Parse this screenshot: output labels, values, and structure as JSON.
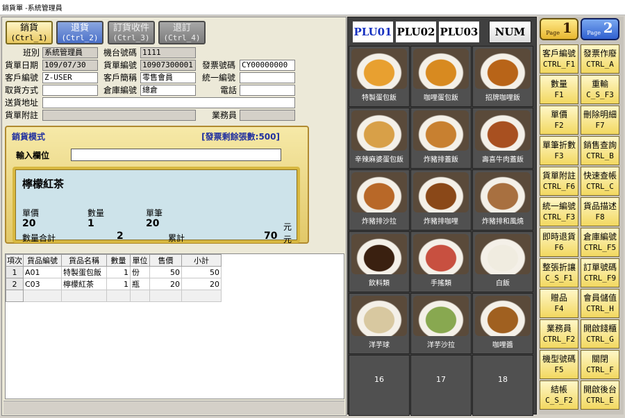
{
  "window": {
    "title": "銷貨單 -系統管理員"
  },
  "mode_tabs": [
    {
      "label": "銷貨",
      "key": "(Ctrl_1)"
    },
    {
      "label": "退貨",
      "key": "(Ctrl_2)"
    },
    {
      "label": "訂貨收件",
      "key": "(Ctrl_3)"
    },
    {
      "label": "退訂",
      "key": "(Ctrl_4)"
    }
  ],
  "header": {
    "shift_label": "班別",
    "shift_value": "系統管理員",
    "machine_label": "機台號碼",
    "machine_value": "1111",
    "date_label": "貨單日期",
    "date_value": "109/07/30",
    "order_no_label": "貨單編號",
    "order_no_value": "10907300001",
    "invoice_no_label": "發票號碼",
    "invoice_no_value": "CY00000000",
    "customer_id_label": "客戶編號",
    "customer_id_value": "Z-USER",
    "customer_name_label": "客戶簡稱",
    "customer_name_value": "零售會員",
    "tax_id_label": "統一編號",
    "tax_id_value": "",
    "pickup_label": "取貨方式",
    "pickup_value": "",
    "warehouse_label": "倉庫編號",
    "warehouse_value": "總倉",
    "phone_label": "電話",
    "phone_value": "",
    "address_label": "送貨地址",
    "address_value": "",
    "note_label": "貨單附註",
    "note_value": "",
    "salesperson_label": "業務員",
    "salesperson_value": ""
  },
  "sale_panel": {
    "mode_title": "銷貨模式",
    "invoice_remaining": "[發票剩餘張數:500]",
    "input_label": "輸入欄位",
    "input_value": "",
    "item_name": "檸檬紅茶",
    "unit_price_label": "單價",
    "unit_price_value": "20",
    "qty_label": "數量",
    "qty_value": "1",
    "subtotal_label": "單筆",
    "subtotal_value": "20",
    "yuan1": "元",
    "total_qty_label": "數量合計",
    "total_qty_value": "2",
    "accum_label": "累計",
    "accum_value": "70",
    "yuan2": "元"
  },
  "grid": {
    "columns": [
      "項次",
      "貨品編號",
      "貨品名稱",
      "數量",
      "單位",
      "售價",
      "小計"
    ],
    "rows": [
      {
        "idx": "1",
        "code": "A01",
        "name": "特製蛋包飯",
        "qty": "1",
        "unit": "份",
        "price": "50",
        "subtotal": "50"
      },
      {
        "idx": "2",
        "code": "C03",
        "name": "檸檬紅茶",
        "qty": "1",
        "unit": "瓶",
        "price": "20",
        "subtotal": "20"
      }
    ]
  },
  "plu_tabs": [
    "PLU01",
    "PLU02",
    "PLU03"
  ],
  "num_label": "NUM",
  "plu_items": [
    {
      "label": "特製蛋包飯",
      "icon": "omelette-rice-photo",
      "color": "#e8a030"
    },
    {
      "label": "咖哩蛋包飯",
      "icon": "curry-omelette-photo",
      "color": "#d88a20"
    },
    {
      "label": "招牌咖哩飯",
      "icon": "curry-rice-photo",
      "color": "#b86418"
    },
    {
      "label": "辛辣麻婆蛋包飯",
      "icon": "mapo-omelette-photo",
      "color": "#d8a048"
    },
    {
      "label": "炸豬排蓋飯",
      "icon": "pork-cutlet-bowl-photo",
      "color": "#c88030"
    },
    {
      "label": "壽喜牛肉蓋飯",
      "icon": "sukiyaki-beef-photo",
      "color": "#a85020"
    },
    {
      "label": "炸豬排沙拉",
      "icon": "pork-cutlet-salad-photo",
      "color": "#b86828"
    },
    {
      "label": "炸豬排咖哩",
      "icon": "pork-cutlet-curry-photo",
      "color": "#8a4818"
    },
    {
      "label": "炸豬排和風燒",
      "icon": "pork-cutlet-okonomi-photo",
      "color": "#a87040"
    },
    {
      "label": "飲料類",
      "icon": "cola-bottle-photo",
      "color": "#3a2010"
    },
    {
      "label": "手搖類",
      "icon": "hand-shaken-drink-photo",
      "color": "#c85040"
    },
    {
      "label": "白飯",
      "icon": "white-rice-photo",
      "color": "#f0ece0"
    },
    {
      "label": "洋芋球",
      "icon": "potato-ball-photo",
      "color": "#d8c8a0"
    },
    {
      "label": "洋芋沙拉",
      "icon": "potato-salad-photo",
      "color": "#88a850"
    },
    {
      "label": "咖哩醬",
      "icon": "curry-sauce-photo",
      "color": "#a06020"
    },
    {
      "label": "16",
      "icon": "",
      "color": ""
    },
    {
      "label": "17",
      "icon": "",
      "color": ""
    },
    {
      "label": "18",
      "icon": "",
      "color": ""
    }
  ],
  "pages": [
    {
      "word": "Page",
      "num": "1"
    },
    {
      "word": "Page",
      "num": "2"
    }
  ],
  "function_buttons": [
    {
      "label": "客戶編號",
      "key": "CTRL_F1"
    },
    {
      "label": "發票作廢",
      "key": "CTRL_A"
    },
    {
      "label": "數量",
      "key": "F1"
    },
    {
      "label": "重輸",
      "key": "C_S_F3"
    },
    {
      "label": "單價",
      "key": "F2"
    },
    {
      "label": "刪除明細",
      "key": "F7"
    },
    {
      "label": "單筆折數",
      "key": "F3"
    },
    {
      "label": "銷售查詢",
      "key": "CTRL_B"
    },
    {
      "label": "貨單附註",
      "key": "CTRL_F6"
    },
    {
      "label": "快速查帳",
      "key": "CTRL_C"
    },
    {
      "label": "統一編號",
      "key": "CTRL_F3"
    },
    {
      "label": "貨品描述",
      "key": "F8"
    },
    {
      "label": "即時退貨",
      "key": "F6"
    },
    {
      "label": "倉庫編號",
      "key": "CTRL_F5"
    },
    {
      "label": "整張折讓",
      "key": "C_S_F1"
    },
    {
      "label": "訂單號碼",
      "key": "CTRL_F9"
    },
    {
      "label": "贈品",
      "key": "F4"
    },
    {
      "label": "會員儲值",
      "key": "CTRL_H"
    },
    {
      "label": "業務員",
      "key": "CTRL_F2"
    },
    {
      "label": "開啟錢櫃",
      "key": "CTRL_G"
    },
    {
      "label": "機型號碼",
      "key": "F5"
    },
    {
      "label": "關閉",
      "key": "CTRL_F"
    },
    {
      "label": "結帳",
      "key": "C_S_F2"
    },
    {
      "label": "開啟後台",
      "key": "CTRL_E"
    }
  ]
}
